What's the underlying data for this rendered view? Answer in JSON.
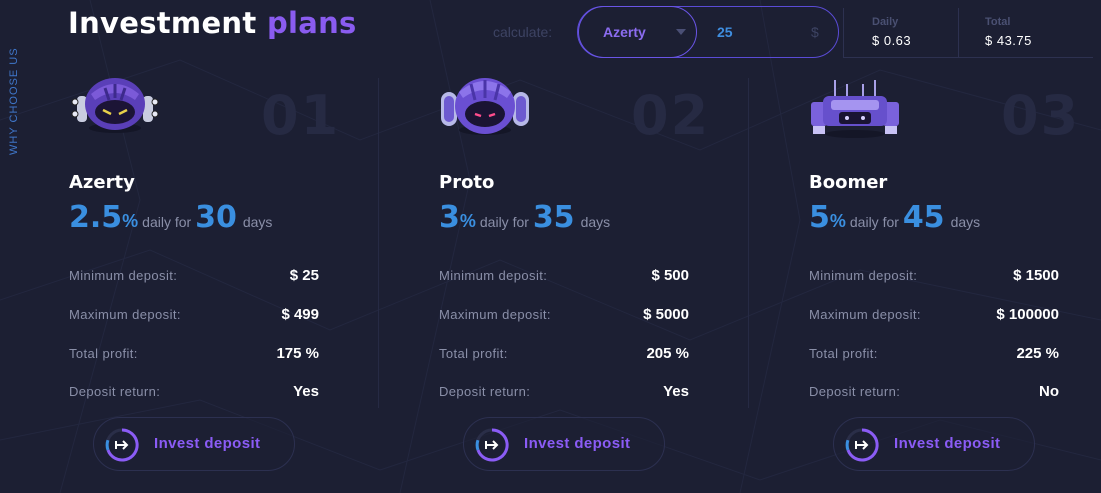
{
  "side_label": "WHY CHOOSE US",
  "header": {
    "title_main": "Investment",
    "title_accent": "plans"
  },
  "calculator": {
    "label": "calculate:",
    "selected_plan": "Azerty",
    "amount": "25",
    "currency": "$",
    "daily_label": "Daily",
    "daily_value": "$ 0.63",
    "total_label": "Total",
    "total_value": "$ 43.75"
  },
  "plans": [
    {
      "number": "01",
      "name": "Azerty",
      "rate": "2.5",
      "pct": "%",
      "daily_for": "daily for",
      "days": "30",
      "days_label": "days",
      "min_label": "Minimum deposit:",
      "min_value": "$ 25",
      "max_label": "Maximum deposit:",
      "max_value": "$ 499",
      "profit_label": "Total profit:",
      "profit_value": "175 %",
      "return_label": "Deposit return:",
      "return_value": "Yes",
      "button": "Invest deposit"
    },
    {
      "number": "02",
      "name": "Proto",
      "rate": "3",
      "pct": "%",
      "daily_for": "daily for",
      "days": "35",
      "days_label": "days",
      "min_label": "Minimum deposit:",
      "min_value": "$ 500",
      "max_label": "Maximum deposit:",
      "max_value": "$ 5000",
      "profit_label": "Total profit:",
      "profit_value": "205 %",
      "return_label": "Deposit return:",
      "return_value": "Yes",
      "button": "Invest deposit"
    },
    {
      "number": "03",
      "name": "Boomer",
      "rate": "5",
      "pct": "%",
      "daily_for": "daily for",
      "days": "45",
      "days_label": "days",
      "min_label": "Minimum deposit:",
      "min_value": "$ 1500",
      "max_label": "Maximum deposit:",
      "max_value": "$ 100000",
      "profit_label": "Total profit:",
      "profit_value": "225 %",
      "return_label": "Deposit return:",
      "return_value": "No",
      "button": "Invest deposit"
    }
  ],
  "colors": {
    "background": "#1c1f33",
    "accent_purple": "#8a5cf0",
    "accent_blue": "#3a8fe0"
  },
  "icons": [
    "robot-azerty-icon",
    "robot-proto-icon",
    "robot-boomer-icon",
    "invest-arrow-icon",
    "select-caret-icon"
  ]
}
